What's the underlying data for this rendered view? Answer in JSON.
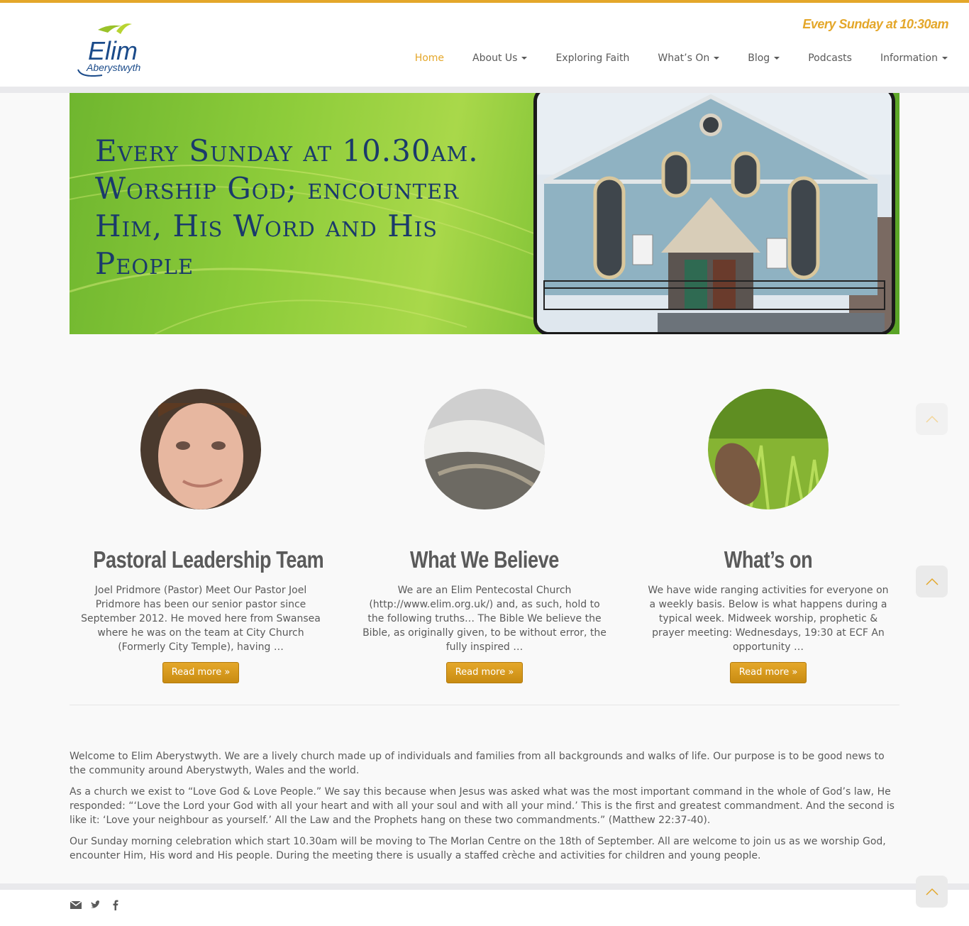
{
  "header": {
    "logo": {
      "brand": "Elim",
      "sub": "Aberystwyth"
    },
    "tagline": "Every Sunday at 10:30am"
  },
  "nav": {
    "home": "Home",
    "about": "About Us",
    "exploring": "Exploring Faith",
    "whatson": "What’s On",
    "blog": "Blog",
    "podcasts": "Podcasts",
    "information": "Information"
  },
  "hero": {
    "lines": [
      "Every Sunday at 10.30am.",
      "Worship God; encounter",
      "Him, His Word and His",
      "People"
    ]
  },
  "features": [
    {
      "title": "Pastoral Leadership Team",
      "text": "Joel Pridmore (Pastor) Meet Our Pastor Joel Pridmore has been our senior pastor since September 2012. He moved here from Swansea where he was on the team at City Church (Formerly City Temple), having …",
      "button": "Read more »"
    },
    {
      "title": "What We Believe",
      "text": "We are an Elim Pentecostal Church (http://www.elim.org.uk/) and, as such, hold to the following truths… The Bible We believe the Bible, as originally given, to be without error, the fully inspired …",
      "button": "Read more »"
    },
    {
      "title": "What’s on",
      "text": "We have wide ranging activities for everyone on a weekly basis. Below is what happens during a typical week. Midweek worship, prophetic & prayer meeting: Wednesdays, 19:30 at ECF   An opportunity …",
      "button": "Read more »"
    }
  ],
  "content": {
    "p1": "Welcome to Elim Aberystwyth. We are a lively church made up of individuals and families from all backgrounds and walks of life. Our purpose is to be good news to the community around Aberystwyth, Wales and the world.",
    "p2": "As a church we exist to “Love God & Love People.” We say this because when Jesus was asked what was the most important command in the whole of God’s law, He responded: “‘Love the Lord your God with all your heart and with all your soul and with all your mind.’ This is the first and greatest commandment. And the second is like it: ‘Love your neighbour as yourself.’ All the Law and the Prophets hang on these two commandments.” (Matthew 22:37-40).",
    "p3": "Our Sunday morning celebration which start 10.30am will be moving to The Morlan Centre on the 18th of September. All are welcome to join us as we worship God, encounter Him, His word and His people. During the meeting there is usually a staffed crèche and activities for children and young people."
  },
  "footer": {
    "social_icons": [
      "envelope-icon",
      "twitter-icon",
      "facebook-icon"
    ]
  },
  "colors": {
    "accent": "#e4a72a",
    "text": "#5a5a5a",
    "hero_text": "#1a3a6b"
  }
}
